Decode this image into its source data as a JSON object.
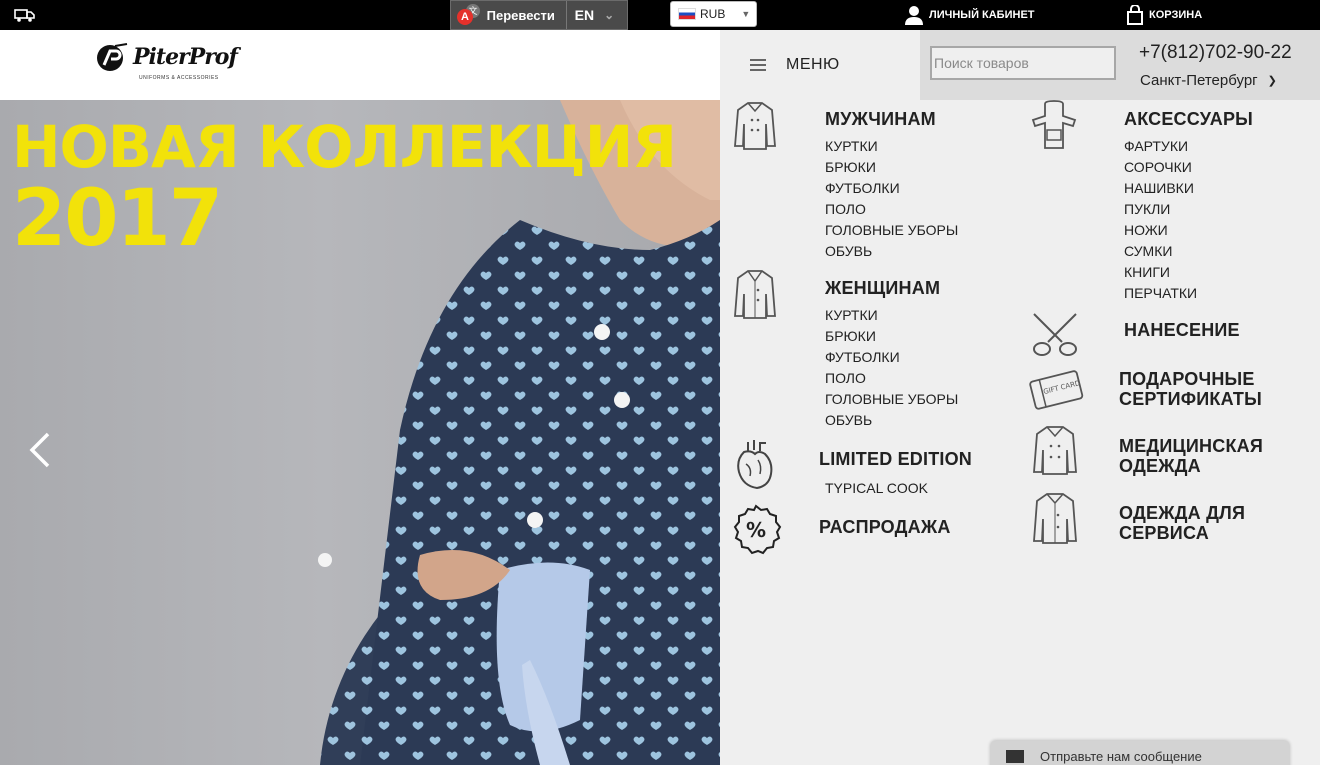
{
  "topbar": {
    "translate_label": "Перевести",
    "language": "EN",
    "currency": "RUB",
    "account_label": "ЛИЧНЫЙ КАБИНЕТ",
    "cart_label": "КОРЗИНА"
  },
  "logo": {
    "name": "PiterProf",
    "tagline": "UNIFORMS & ACCESSORIES"
  },
  "hero": {
    "title_line1": "НОВАЯ КОЛЛЕКЦИЯ",
    "title_line2": "2017"
  },
  "header": {
    "menu_label": "МЕНЮ",
    "search_placeholder": "Поиск товаров",
    "phone": "+7(812)702-90-22",
    "city": "Санкт-Петербург"
  },
  "menu": {
    "men": {
      "title": "МУЖЧИНАМ",
      "items": [
        "КУРТКИ",
        "БРЮКИ",
        "ФУТБОЛКИ",
        "ПОЛО",
        "ГОЛОВНЫЕ УБОРЫ",
        "ОБУВЬ"
      ]
    },
    "women": {
      "title": "ЖЕНЩИНАМ",
      "items": [
        "КУРТКИ",
        "БРЮКИ",
        "ФУТБОЛКИ",
        "ПОЛО",
        "ГОЛОВНЫЕ УБОРЫ",
        "ОБУВЬ"
      ]
    },
    "limited": {
      "title": "LIMITED EDITION",
      "items": [
        "TYPICAL COOK"
      ]
    },
    "sale": {
      "title": "РАСПРОДАЖА"
    },
    "accessories": {
      "title": "АКСЕССУАРЫ",
      "items": [
        "ФАРТУКИ",
        "СОРОЧКИ",
        "НАШИВКИ",
        "ПУКЛИ",
        "НОЖИ",
        "СУМКИ",
        "КНИГИ",
        "ПЕРЧАТКИ"
      ]
    },
    "printing": {
      "title": "НАНЕСЕНИЕ"
    },
    "gift": {
      "title_line1": "ПОДАРОЧНЫЕ",
      "title_line2": "СЕРТИФИКАТЫ",
      "card_text": "GIFT CARD"
    },
    "medical": {
      "title_line1": "МЕДИЦИНСКАЯ",
      "title_line2": "ОДЕЖДА"
    },
    "service": {
      "title_line1": "ОДЕЖДА ДЛЯ",
      "title_line2": "СЕРВИСА"
    }
  },
  "chat": {
    "label": "Отправьте нам сообщение"
  }
}
